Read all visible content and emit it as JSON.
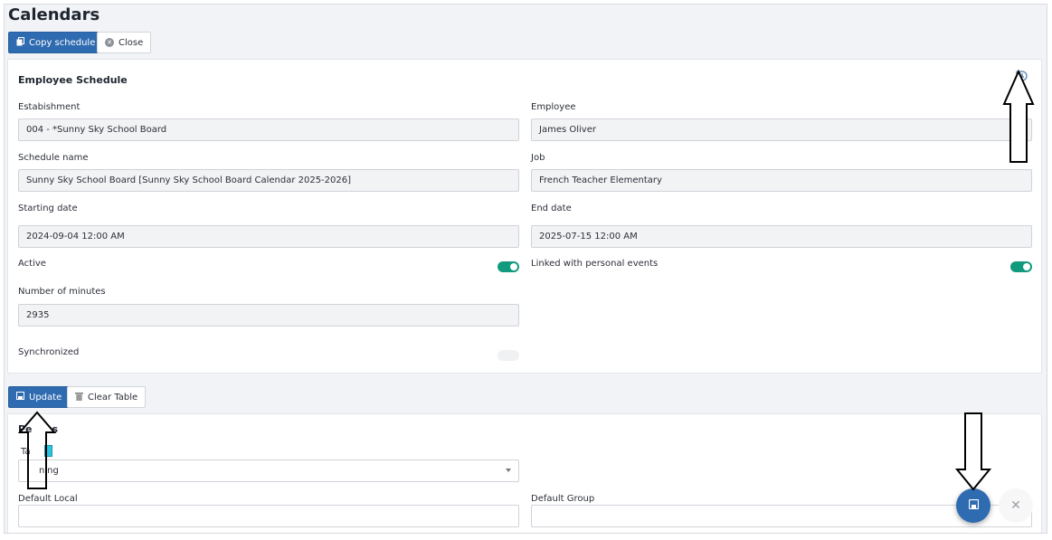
{
  "page": {
    "title": "Calendars"
  },
  "toolbar": {
    "copy_label": "Copy schedule",
    "close_label": "Close"
  },
  "card": {
    "title": "Employee Schedule",
    "establishment": {
      "label": "Estabishment",
      "value": "004 - *Sunny Sky School Board"
    },
    "employee": {
      "label": "Employee",
      "value": "James  Oliver"
    },
    "schedule_name": {
      "label": "Schedule name",
      "value": "Sunny Sky School Board [Sunny Sky School Board Calendar 2025-2026]"
    },
    "job": {
      "label": "Job",
      "value": "French Teacher Elementary"
    },
    "starting_date": {
      "label": "Starting date",
      "value": "2024-09-04 12:00 AM"
    },
    "end_date": {
      "label": "End date",
      "value": "2025-07-15 12:00 AM"
    },
    "active": {
      "label": "Active",
      "on": true
    },
    "linked": {
      "label": "Linked with personal events",
      "on": true
    },
    "minutes": {
      "label": "Number of minutes",
      "value": "2935"
    },
    "synchronized": {
      "label": "Synchronized",
      "on": false
    }
  },
  "actions": {
    "update_label": "Update",
    "clear_label": "Clear Table"
  },
  "periods": {
    "title_visible": "Pe",
    "title_tail": "s",
    "type_label_visible": "Ta",
    "type_value_visible": "ning",
    "default_local_label": "Default Local",
    "default_group_label": "Default Group"
  },
  "fab": {
    "close_glyph": "✕"
  },
  "colors": {
    "primary": "#2f6bb0",
    "toggle_on": "#129a7e",
    "history_icon": "#5b87b8"
  }
}
